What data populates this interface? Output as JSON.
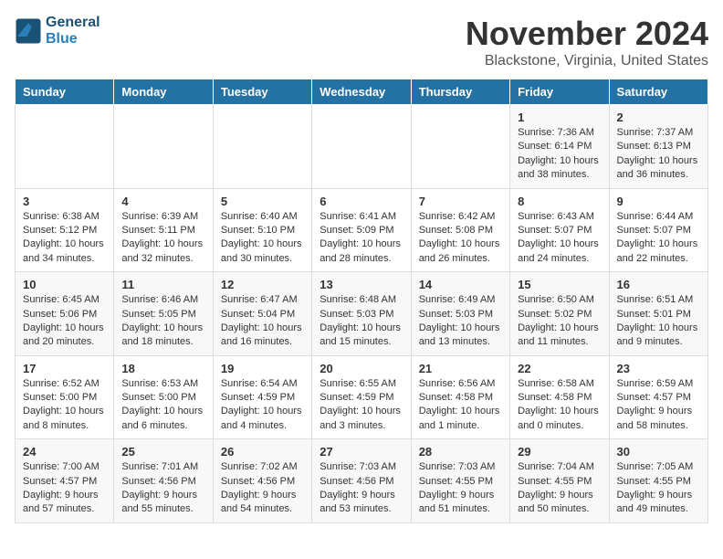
{
  "header": {
    "logo_line1": "General",
    "logo_line2": "Blue",
    "month": "November 2024",
    "location": "Blackstone, Virginia, United States"
  },
  "weekdays": [
    "Sunday",
    "Monday",
    "Tuesday",
    "Wednesday",
    "Thursday",
    "Friday",
    "Saturday"
  ],
  "weeks": [
    [
      {
        "day": "",
        "info": ""
      },
      {
        "day": "",
        "info": ""
      },
      {
        "day": "",
        "info": ""
      },
      {
        "day": "",
        "info": ""
      },
      {
        "day": "",
        "info": ""
      },
      {
        "day": "1",
        "info": "Sunrise: 7:36 AM\nSunset: 6:14 PM\nDaylight: 10 hours and 38 minutes."
      },
      {
        "day": "2",
        "info": "Sunrise: 7:37 AM\nSunset: 6:13 PM\nDaylight: 10 hours and 36 minutes."
      }
    ],
    [
      {
        "day": "3",
        "info": "Sunrise: 6:38 AM\nSunset: 5:12 PM\nDaylight: 10 hours and 34 minutes."
      },
      {
        "day": "4",
        "info": "Sunrise: 6:39 AM\nSunset: 5:11 PM\nDaylight: 10 hours and 32 minutes."
      },
      {
        "day": "5",
        "info": "Sunrise: 6:40 AM\nSunset: 5:10 PM\nDaylight: 10 hours and 30 minutes."
      },
      {
        "day": "6",
        "info": "Sunrise: 6:41 AM\nSunset: 5:09 PM\nDaylight: 10 hours and 28 minutes."
      },
      {
        "day": "7",
        "info": "Sunrise: 6:42 AM\nSunset: 5:08 PM\nDaylight: 10 hours and 26 minutes."
      },
      {
        "day": "8",
        "info": "Sunrise: 6:43 AM\nSunset: 5:07 PM\nDaylight: 10 hours and 24 minutes."
      },
      {
        "day": "9",
        "info": "Sunrise: 6:44 AM\nSunset: 5:07 PM\nDaylight: 10 hours and 22 minutes."
      }
    ],
    [
      {
        "day": "10",
        "info": "Sunrise: 6:45 AM\nSunset: 5:06 PM\nDaylight: 10 hours and 20 minutes."
      },
      {
        "day": "11",
        "info": "Sunrise: 6:46 AM\nSunset: 5:05 PM\nDaylight: 10 hours and 18 minutes."
      },
      {
        "day": "12",
        "info": "Sunrise: 6:47 AM\nSunset: 5:04 PM\nDaylight: 10 hours and 16 minutes."
      },
      {
        "day": "13",
        "info": "Sunrise: 6:48 AM\nSunset: 5:03 PM\nDaylight: 10 hours and 15 minutes."
      },
      {
        "day": "14",
        "info": "Sunrise: 6:49 AM\nSunset: 5:03 PM\nDaylight: 10 hours and 13 minutes."
      },
      {
        "day": "15",
        "info": "Sunrise: 6:50 AM\nSunset: 5:02 PM\nDaylight: 10 hours and 11 minutes."
      },
      {
        "day": "16",
        "info": "Sunrise: 6:51 AM\nSunset: 5:01 PM\nDaylight: 10 hours and 9 minutes."
      }
    ],
    [
      {
        "day": "17",
        "info": "Sunrise: 6:52 AM\nSunset: 5:00 PM\nDaylight: 10 hours and 8 minutes."
      },
      {
        "day": "18",
        "info": "Sunrise: 6:53 AM\nSunset: 5:00 PM\nDaylight: 10 hours and 6 minutes."
      },
      {
        "day": "19",
        "info": "Sunrise: 6:54 AM\nSunset: 4:59 PM\nDaylight: 10 hours and 4 minutes."
      },
      {
        "day": "20",
        "info": "Sunrise: 6:55 AM\nSunset: 4:59 PM\nDaylight: 10 hours and 3 minutes."
      },
      {
        "day": "21",
        "info": "Sunrise: 6:56 AM\nSunset: 4:58 PM\nDaylight: 10 hours and 1 minute."
      },
      {
        "day": "22",
        "info": "Sunrise: 6:58 AM\nSunset: 4:58 PM\nDaylight: 10 hours and 0 minutes."
      },
      {
        "day": "23",
        "info": "Sunrise: 6:59 AM\nSunset: 4:57 PM\nDaylight: 9 hours and 58 minutes."
      }
    ],
    [
      {
        "day": "24",
        "info": "Sunrise: 7:00 AM\nSunset: 4:57 PM\nDaylight: 9 hours and 57 minutes."
      },
      {
        "day": "25",
        "info": "Sunrise: 7:01 AM\nSunset: 4:56 PM\nDaylight: 9 hours and 55 minutes."
      },
      {
        "day": "26",
        "info": "Sunrise: 7:02 AM\nSunset: 4:56 PM\nDaylight: 9 hours and 54 minutes."
      },
      {
        "day": "27",
        "info": "Sunrise: 7:03 AM\nSunset: 4:56 PM\nDaylight: 9 hours and 53 minutes."
      },
      {
        "day": "28",
        "info": "Sunrise: 7:03 AM\nSunset: 4:55 PM\nDaylight: 9 hours and 51 minutes."
      },
      {
        "day": "29",
        "info": "Sunrise: 7:04 AM\nSunset: 4:55 PM\nDaylight: 9 hours and 50 minutes."
      },
      {
        "day": "30",
        "info": "Sunrise: 7:05 AM\nSunset: 4:55 PM\nDaylight: 9 hours and 49 minutes."
      }
    ]
  ]
}
